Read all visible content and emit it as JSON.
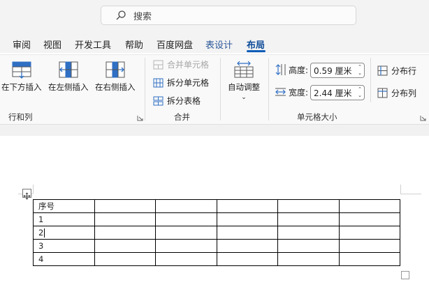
{
  "search": {
    "placeholder": "搜索"
  },
  "tabs": [
    {
      "label": "审阅"
    },
    {
      "label": "视图"
    },
    {
      "label": "开发工具"
    },
    {
      "label": "帮助"
    },
    {
      "label": "百度网盘"
    },
    {
      "label": "表设计"
    },
    {
      "label": "布局"
    }
  ],
  "ribbon": {
    "rows_cols": {
      "insert_below": "在下方插入",
      "insert_left": "在左侧插入",
      "insert_right": "在右侧插入",
      "group_label": "行和列"
    },
    "merge": {
      "merge_cells": "合并单元格",
      "split_cells": "拆分单元格",
      "split_table": "拆分表格",
      "group_label": "合并"
    },
    "cell_size": {
      "autofit": "自动调整",
      "height_label": "高度:",
      "height_value": "0.59 厘米",
      "width_label": "宽度:",
      "width_value": "2.44 厘米",
      "distribute_rows": "分布行",
      "distribute_cols": "分布列",
      "group_label": "单元格大小"
    }
  },
  "table": {
    "header": "序号",
    "rows": [
      "1",
      "2",
      "3",
      "4"
    ]
  },
  "colors": {
    "accent": "#0f5cb8",
    "tab_accent": "#2b579a",
    "icon_blue": "#2f6fc4"
  }
}
